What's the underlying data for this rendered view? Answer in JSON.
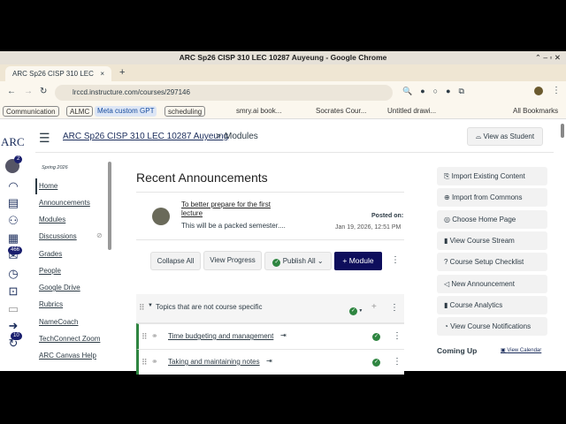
{
  "window": {
    "title": "ARC Sp26 CISP 310 LEC 10287 Auyeung - Google Chrome"
  },
  "tab": {
    "label": "ARC Sp26 CISP 310 LEC",
    "close": "×",
    "new_tab": "+"
  },
  "address": {
    "url": "lrccd.instructure.com/courses/297146"
  },
  "bookmarks": {
    "items": [
      "Communication",
      "ALMC",
      "Meta custom GPT",
      "scheduling"
    ],
    "links": [
      "smry.ai book...",
      "Socrates Cour...",
      "Untitled drawi..."
    ],
    "all": "All Bookmarks"
  },
  "logo": "ARC",
  "header": {
    "course": "ARC Sp26 CISP 310 LEC 10287 Auyeung",
    "separator": ">",
    "current": "Modules",
    "view_as_student": "View as Student"
  },
  "global_nav": {
    "account_badge": "2",
    "inbox_badge": "466",
    "help_badge": "10"
  },
  "course_nav": {
    "term": "Spring 2026",
    "items": [
      "Home",
      "Announcements",
      "Modules",
      "Discussions",
      "Grades",
      "People",
      "Google Drive",
      "Rubrics",
      "NameCoach",
      "TechConnect Zoom",
      "ARC Canvas Help"
    ]
  },
  "announcements": {
    "heading": "Recent Announcements",
    "title": "To better prepare for the first lecture",
    "snippet": "This will be a packed semester....",
    "posted_label": "Posted on:",
    "posted_date": "Jan 19, 2026, 12:51 PM"
  },
  "toolbar": {
    "collapse": "Collapse All",
    "progress": "View Progress",
    "publish": "Publish All",
    "add_module": "+ Module"
  },
  "module": {
    "title": "Topics that are not course specific",
    "items": [
      "Time budgeting and management",
      "Taking and maintaining notes"
    ]
  },
  "sidebar": {
    "buttons": [
      "Import Existing Content",
      "Import from Commons",
      "Choose Home Page",
      "View Course Stream",
      "Course Setup Checklist",
      "New Announcement",
      "Course Analytics",
      "View Course Notifications"
    ],
    "coming_up": "Coming Up",
    "view_calendar": "View Calendar"
  }
}
